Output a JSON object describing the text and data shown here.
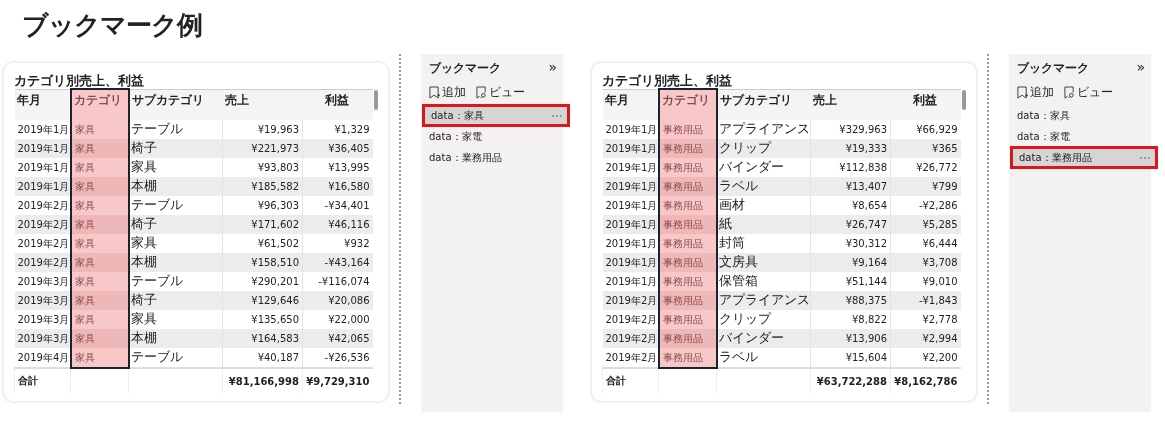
{
  "page_title": "ブックマーク例",
  "examples": [
    {
      "table": {
        "title": "カテゴリ別売上、利益",
        "columns": [
          {
            "label": "年月",
            "highlighted": false
          },
          {
            "label": "カテゴリ",
            "highlighted": true
          },
          {
            "label": "サブカテゴリ",
            "highlighted": false
          },
          {
            "label": "売上",
            "highlighted": false
          },
          {
            "label": "利益",
            "highlighted": false
          }
        ],
        "rows": [
          [
            "2019年1月",
            "家具",
            "テーブル",
            "¥19,963",
            "¥1,329"
          ],
          [
            "2019年1月",
            "家具",
            "椅子",
            "¥221,973",
            "¥36,405"
          ],
          [
            "2019年1月",
            "家具",
            "家具",
            "¥93,803",
            "¥13,995"
          ],
          [
            "2019年1月",
            "家具",
            "本棚",
            "¥185,582",
            "¥16,580"
          ],
          [
            "2019年2月",
            "家具",
            "テーブル",
            "¥96,303",
            "-¥34,401"
          ],
          [
            "2019年2月",
            "家具",
            "椅子",
            "¥171,602",
            "¥46,116"
          ],
          [
            "2019年2月",
            "家具",
            "家具",
            "¥61,502",
            "¥932"
          ],
          [
            "2019年2月",
            "家具",
            "本棚",
            "¥158,510",
            "-¥43,164"
          ],
          [
            "2019年3月",
            "家具",
            "テーブル",
            "¥290,201",
            "-¥116,074"
          ],
          [
            "2019年3月",
            "家具",
            "椅子",
            "¥129,646",
            "¥20,086"
          ],
          [
            "2019年3月",
            "家具",
            "家具",
            "¥135,650",
            "¥22,000"
          ],
          [
            "2019年3月",
            "家具",
            "本棚",
            "¥164,583",
            "¥42,065"
          ],
          [
            "2019年4月",
            "家具",
            "テーブル",
            "¥40,187",
            "-¥26,536"
          ]
        ],
        "total": {
          "label": "合計",
          "sales": "¥81,166,998",
          "profit": "¥9,729,310"
        }
      },
      "bookmarks": {
        "title": "ブックマーク",
        "collapse": "»",
        "add": "追加",
        "view": "ビュー",
        "items": [
          {
            "label": "data：家具",
            "selected": true
          },
          {
            "label": "data：家電",
            "selected": false
          },
          {
            "label": "data：業務用品",
            "selected": false
          }
        ]
      }
    },
    {
      "table": {
        "title": "カテゴリ別売上、利益",
        "columns": [
          {
            "label": "年月",
            "highlighted": false
          },
          {
            "label": "カテゴリ",
            "highlighted": true
          },
          {
            "label": "サブカテゴリ",
            "highlighted": false
          },
          {
            "label": "売上",
            "highlighted": false
          },
          {
            "label": "利益",
            "highlighted": false
          }
        ],
        "rows": [
          [
            "2019年1月",
            "事務用品",
            "アプライアンス",
            "¥329,963",
            "¥66,929"
          ],
          [
            "2019年1月",
            "事務用品",
            "クリップ",
            "¥19,333",
            "¥365"
          ],
          [
            "2019年1月",
            "事務用品",
            "バインダー",
            "¥112,838",
            "¥26,772"
          ],
          [
            "2019年1月",
            "事務用品",
            "ラベル",
            "¥13,407",
            "¥799"
          ],
          [
            "2019年1月",
            "事務用品",
            "画材",
            "¥8,654",
            "-¥2,286"
          ],
          [
            "2019年1月",
            "事務用品",
            "紙",
            "¥26,747",
            "¥5,285"
          ],
          [
            "2019年1月",
            "事務用品",
            "封筒",
            "¥30,312",
            "¥6,444"
          ],
          [
            "2019年1月",
            "事務用品",
            "文房具",
            "¥9,164",
            "¥3,708"
          ],
          [
            "2019年1月",
            "事務用品",
            "保管箱",
            "¥51,144",
            "¥9,010"
          ],
          [
            "2019年2月",
            "事務用品",
            "アプライアンス",
            "¥88,375",
            "-¥1,843"
          ],
          [
            "2019年2月",
            "事務用品",
            "クリップ",
            "¥8,822",
            "¥2,778"
          ],
          [
            "2019年2月",
            "事務用品",
            "バインダー",
            "¥13,906",
            "¥2,994"
          ],
          [
            "2019年2月",
            "事務用品",
            "ラベル",
            "¥15,604",
            "¥2,200"
          ]
        ],
        "total": {
          "label": "合計",
          "sales": "¥63,722,288",
          "profit": "¥8,162,786"
        }
      },
      "bookmarks": {
        "title": "ブックマーク",
        "collapse": "»",
        "add": "追加",
        "view": "ビュー",
        "items": [
          {
            "label": "data：家具",
            "selected": false
          },
          {
            "label": "data：家電",
            "selected": false
          },
          {
            "label": "data：業務用品",
            "selected": true
          }
        ]
      }
    }
  ]
}
